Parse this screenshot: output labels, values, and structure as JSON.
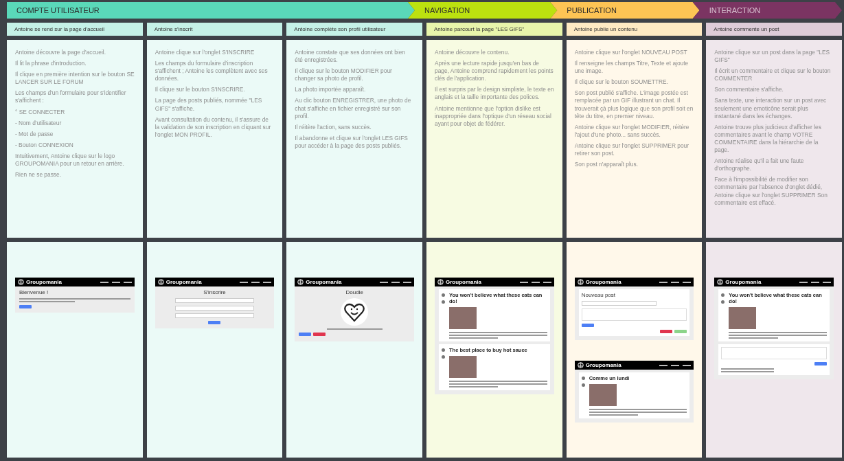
{
  "phases": [
    {
      "title": "COMPTE UTILISATEUR",
      "color": "#5ad8b9",
      "steps": [
        {
          "heading": "Antoine se rend sur la page d'accueil",
          "notes": [
            "Antoine découvre la page d'accueil.",
            "Il lit la phrase d'introduction.",
            "Il clique en première intention sur le bouton SE LANCER SUR LE FORUM",
            "Les champs d'un formulaire pour s'identifier s'affichent :",
            "° SE CONNECTER",
            "- Nom d'utilisateur",
            "- Mot de passe",
            "- Bouton CONNEXION",
            "Intuitivement, Antoine clique sur le logo GROUPOMANIA pour un retour en arrière.",
            "Rien ne se passe."
          ],
          "screens": [
            {
              "kind": "welcome",
              "brand": "Groupomania",
              "title": "Bienvenue !"
            }
          ]
        },
        {
          "heading": "Antoine s'inscrit",
          "notes": [
            "Antoine clique sur l'onglet S'INSCRIRE",
            "Les champs du formulaire d'inscription s'affichent ; Antoine les complètent avec ses données.",
            "Il clique sur le bouton S'INSCRIRE.",
            "La page des posts publiés, nommée \"LES GIFS\" s'affiche.",
            "Avant consultation du contenu, il s'assure de la validation de son inscription en cliquant sur l'onglet MON PROFIL."
          ],
          "screens": [
            {
              "kind": "signup",
              "brand": "Groupomania",
              "title": "S'inscrire"
            }
          ]
        },
        {
          "heading": "Antoine complète son profil utilisateur",
          "notes": [
            "Antoine constate que ses données ont bien été enregistrées.",
            "Il clique sur le bouton MODIFIER pour changer sa photo de profil.",
            "La photo importée apparaît.",
            "Au clic bouton ENREGISTRER, une photo de chat s'affiche en fichier enregistré sur son profil.",
            "Il réitère l'action, sans succès.",
            "Il abandonne et clique sur l'onglet LES GIFS pour accéder à la page des posts publiés."
          ],
          "screens": [
            {
              "kind": "profile",
              "brand": "Groupomania",
              "title": "Doudle"
            }
          ]
        }
      ]
    },
    {
      "title": "NAVIGATION",
      "color": "#bce10f",
      "steps": [
        {
          "heading": "Antoine parcourt la page \"LES GIFS\"",
          "notes": [
            "Antoine découvre le contenu.",
            "Après une lecture rapide jusqu'en bas de page, Antoine comprend rapidement les points clés de l'application.",
            "Il est surpris par le design simpliste, le texte en anglais et la taille importante des polices.",
            "Antoine mentionne que l'option dislike est inappropriée dans l'optique d'un réseau social ayant pour objet de fédérer."
          ],
          "screens": [
            {
              "kind": "feed",
              "brand": "Groupomania",
              "posts": [
                "You won't believe what these cats can do!",
                "The best place to buy hot sauce"
              ]
            }
          ]
        }
      ]
    },
    {
      "title": "PUBLICATION",
      "color": "#fdc454",
      "steps": [
        {
          "heading": "Antoine publie un contenu",
          "notes": [
            "Antoine clique sur l'onglet NOUVEAU POST",
            "Il renseigne les champs Titre, Texte et ajoute une image.",
            "Il clique sur le bouton SOUMETTRE.",
            "Son post publié s'affiche. L'image postée est remplacée par un GIF illustrant un chat. Il trouverait çà plus logique que son profil soit en tête du titre, en premier niveau.",
            "Antoine clique sur l'onglet MODIFIER, réitère l'ajout d'une photo... sans succès.",
            "Antoine clique sur l'onglet SUPPRIMER pour retirer son post.",
            "Son post n'apparaît plus."
          ],
          "screens": [
            {
              "kind": "newpost",
              "brand": "Groupomania",
              "title": "Nouveau post"
            },
            {
              "kind": "feed",
              "brand": "Groupomania",
              "posts": [
                "Comme un lundi"
              ]
            }
          ]
        }
      ]
    },
    {
      "title": "INTERACTION",
      "color": "#7b3462",
      "steps": [
        {
          "heading": "Antoine commente un post",
          "notes": [
            "Antoine clique sur un post dans la page \"LES GIFS\"",
            "Il écrit un commentaire et clique sur le bouton COMMENTER",
            "Son commentaire s'affiche.",
            "Sans texte, une interaction sur un post avec seulement une emoticône serait plus instantané dans les échanges.",
            "Antoine trouve plus judicieux d'afficher les commentaires avant le champ VOTRE COMMENTAIRE dans la hiérarchie de la page.",
            "Antoine réalise qu'il a fait une faute d'orthographe.",
            "Face à l'impossibilité de modifier son commentaire par l'absence d'onglet dédié, Antoine clique sur l'onglet SUPPRIMER Son commentaire est effacé."
          ],
          "screens": [
            {
              "kind": "comment",
              "brand": "Groupomania",
              "title": "You won't believe what these cats can do!"
            }
          ]
        }
      ]
    }
  ]
}
